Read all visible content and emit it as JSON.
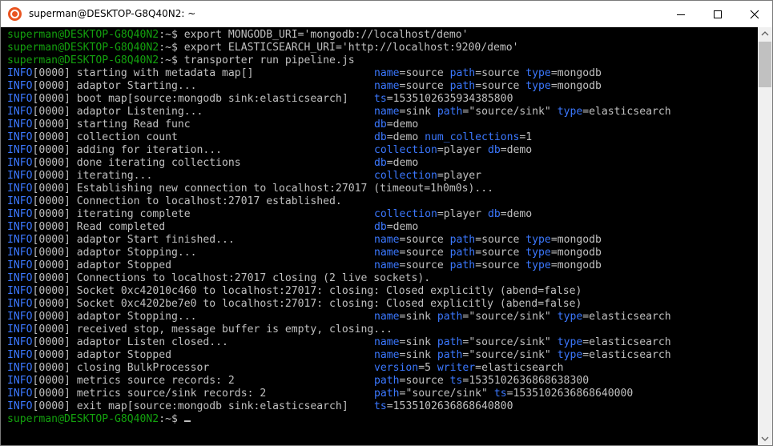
{
  "window": {
    "title": "superman@DESKTOP-G8Q40N2: ~",
    "minimize_icon": "minimize-icon",
    "maximize_icon": "maximize-icon",
    "close_icon": "close-icon"
  },
  "colors": {
    "prompt": "#13a10e",
    "log_level": "#3b78ff",
    "text": "#c0c0c0",
    "background": "#000000"
  },
  "terminal": {
    "prompts": [
      {
        "prompt": "superman@DESKTOP-G8Q40N2",
        "sep": ":~$ ",
        "cmd": "export MONGODB_URI='mongodb://localhost/demo'"
      },
      {
        "prompt": "superman@DESKTOP-G8Q40N2",
        "sep": ":~$ ",
        "cmd": "export ELASTICSEARCH_URI='http://localhost:9200/demo'"
      },
      {
        "prompt": "superman@DESKTOP-G8Q40N2",
        "sep": ":~$ ",
        "cmd": "transporter run pipeline.js"
      }
    ],
    "logs": [
      {
        "level": "INFO",
        "msg": "[0000] starting with metadata map[]",
        "fields": [
          {
            "k": "name",
            "v": "source"
          },
          {
            "k": "path",
            "v": "source"
          },
          {
            "k": "type",
            "v": "mongodb"
          }
        ]
      },
      {
        "level": "INFO",
        "msg": "[0000] adaptor Starting...",
        "fields": [
          {
            "k": "name",
            "v": "source"
          },
          {
            "k": "path",
            "v": "source"
          },
          {
            "k": "type",
            "v": "mongodb"
          }
        ]
      },
      {
        "level": "INFO",
        "msg": "[0000] boot map[source:mongodb sink:elasticsearch]",
        "fields": [
          {
            "k": "ts",
            "v": "1535102635934385800"
          }
        ]
      },
      {
        "level": "INFO",
        "msg": "[0000] adaptor Listening...",
        "fields": [
          {
            "k": "name",
            "v": "sink"
          },
          {
            "k": "path",
            "v": "\"source/sink\""
          },
          {
            "k": "type",
            "v": "elasticsearch"
          }
        ]
      },
      {
        "level": "INFO",
        "msg": "[0000] starting Read func",
        "fields": [
          {
            "k": "db",
            "v": "demo"
          }
        ]
      },
      {
        "level": "INFO",
        "msg": "[0000] collection count",
        "fields": [
          {
            "k": "db",
            "v": "demo"
          },
          {
            "k": "num_collections",
            "v": "1"
          }
        ]
      },
      {
        "level": "INFO",
        "msg": "[0000] adding for iteration...",
        "fields": [
          {
            "k": "collection",
            "v": "player"
          },
          {
            "k": "db",
            "v": "demo"
          }
        ]
      },
      {
        "level": "INFO",
        "msg": "[0000] done iterating collections",
        "fields": [
          {
            "k": "db",
            "v": "demo"
          }
        ]
      },
      {
        "level": "INFO",
        "msg": "[0000] iterating...",
        "fields": [
          {
            "k": "collection",
            "v": "player"
          }
        ]
      },
      {
        "level": "INFO",
        "msg": "[0000] Establishing new connection to localhost:27017 (timeout=1h0m0s)...",
        "fields": []
      },
      {
        "level": "INFO",
        "msg": "[0000] Connection to localhost:27017 established.",
        "fields": []
      },
      {
        "level": "INFO",
        "msg": "[0000] iterating complete",
        "fields": [
          {
            "k": "collection",
            "v": "player"
          },
          {
            "k": "db",
            "v": "demo"
          }
        ]
      },
      {
        "level": "INFO",
        "msg": "[0000] Read completed",
        "fields": [
          {
            "k": "db",
            "v": "demo"
          }
        ]
      },
      {
        "level": "INFO",
        "msg": "[0000] adaptor Start finished...",
        "fields": [
          {
            "k": "name",
            "v": "source"
          },
          {
            "k": "path",
            "v": "source"
          },
          {
            "k": "type",
            "v": "mongodb"
          }
        ]
      },
      {
        "level": "INFO",
        "msg": "[0000] adaptor Stopping...",
        "fields": [
          {
            "k": "name",
            "v": "source"
          },
          {
            "k": "path",
            "v": "source"
          },
          {
            "k": "type",
            "v": "mongodb"
          }
        ]
      },
      {
        "level": "INFO",
        "msg": "[0000] adaptor Stopped",
        "fields": [
          {
            "k": "name",
            "v": "source"
          },
          {
            "k": "path",
            "v": "source"
          },
          {
            "k": "type",
            "v": "mongodb"
          }
        ]
      },
      {
        "level": "INFO",
        "msg": "[0000] Connections to localhost:27017 closing (2 live sockets).",
        "fields": []
      },
      {
        "level": "INFO",
        "msg": "[0000] Socket 0xc42010c460 to localhost:27017: closing: Closed explicitly (abend=false)",
        "fields": []
      },
      {
        "level": "INFO",
        "msg": "[0000] Socket 0xc4202be7e0 to localhost:27017: closing: Closed explicitly (abend=false)",
        "fields": []
      },
      {
        "level": "INFO",
        "msg": "[0000] adaptor Stopping...",
        "fields": [
          {
            "k": "name",
            "v": "sink"
          },
          {
            "k": "path",
            "v": "\"source/sink\""
          },
          {
            "k": "type",
            "v": "elasticsearch"
          }
        ]
      },
      {
        "level": "INFO",
        "msg": "[0000] received stop, message buffer is empty, closing...",
        "fields": []
      },
      {
        "level": "INFO",
        "msg": "[0000] adaptor Listen closed...",
        "fields": [
          {
            "k": "name",
            "v": "sink"
          },
          {
            "k": "path",
            "v": "\"source/sink\""
          },
          {
            "k": "type",
            "v": "elasticsearch"
          }
        ]
      },
      {
        "level": "INFO",
        "msg": "[0000] adaptor Stopped",
        "fields": [
          {
            "k": "name",
            "v": "sink"
          },
          {
            "k": "path",
            "v": "\"source/sink\""
          },
          {
            "k": "type",
            "v": "elasticsearch"
          }
        ]
      },
      {
        "level": "INFO",
        "msg": "[0000] closing BulkProcessor",
        "fields": [
          {
            "k": "version",
            "v": "5"
          },
          {
            "k": "writer",
            "v": "elasticsearch"
          }
        ]
      },
      {
        "level": "INFO",
        "msg": "[0000] metrics source records: 2",
        "fields": [
          {
            "k": "path",
            "v": "source"
          },
          {
            "k": "ts",
            "v": "1535102636868638300"
          }
        ]
      },
      {
        "level": "INFO",
        "msg": "[0000] metrics source/sink records: 2",
        "fields": [
          {
            "k": "path",
            "v": "\"source/sink\""
          },
          {
            "k": "ts",
            "v": "1535102636868640000"
          }
        ]
      },
      {
        "level": "INFO",
        "msg": "[0000] exit map[source:mongodb sink:elasticsearch]",
        "fields": [
          {
            "k": "ts",
            "v": "1535102636868640800"
          }
        ]
      }
    ],
    "final_prompt": {
      "prompt": "superman@DESKTOP-G8Q40N2",
      "sep": ":~$ ",
      "cmd": ""
    }
  }
}
